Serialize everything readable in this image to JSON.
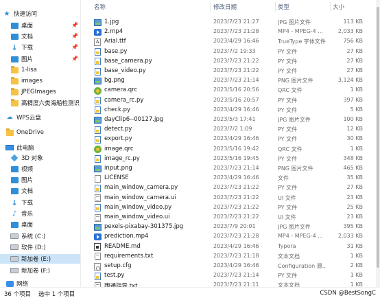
{
  "sidebar": {
    "items": [
      {
        "label": "快速访问",
        "icon": "star-icon"
      },
      {
        "label": "桌面",
        "icon": "desktop-folder-icon",
        "pinned": true
      },
      {
        "label": "文档",
        "icon": "documents-folder-icon",
        "pinned": true
      },
      {
        "label": "下载",
        "icon": "download-arrow-icon",
        "pinned": true
      },
      {
        "label": "图片",
        "icon": "pictures-folder-icon",
        "pinned": true
      },
      {
        "label": "1-lisa",
        "icon": "folder-icon"
      },
      {
        "label": "images",
        "icon": "folder-icon"
      },
      {
        "label": "JPEGImages",
        "icon": "folder-icon"
      },
      {
        "label": "高精度六类海船检测识",
        "icon": "folder-icon"
      },
      {
        "label": "WPS云盘",
        "icon": "cloud-icon"
      },
      {
        "label": "OneDrive",
        "icon": "onedrive-folder-icon"
      },
      {
        "label": "此电脑",
        "icon": "computer-icon"
      },
      {
        "label": "3D 对象",
        "icon": "3d-objects-icon"
      },
      {
        "label": "视频",
        "icon": "videos-folder-icon"
      },
      {
        "label": "图片",
        "icon": "pictures-folder-icon"
      },
      {
        "label": "文档",
        "icon": "documents-folder-icon"
      },
      {
        "label": "下载",
        "icon": "download-arrow-icon"
      },
      {
        "label": "音乐",
        "icon": "music-icon"
      },
      {
        "label": "桌面",
        "icon": "desktop-folder-icon"
      },
      {
        "label": "系统 (C:)",
        "icon": "drive-icon"
      },
      {
        "label": "软件 (D:)",
        "icon": "drive-icon"
      },
      {
        "label": "新加卷 (E:)",
        "icon": "drive-icon",
        "selected": true
      },
      {
        "label": "新加卷 (F:)",
        "icon": "drive-icon"
      },
      {
        "label": "网络",
        "icon": "network-icon"
      }
    ]
  },
  "columns": {
    "name": "名称",
    "date": "修改日期",
    "type": "类型",
    "size": "大小"
  },
  "files": [
    {
      "name": "1.jpg",
      "date": "2023/7/23 21:27",
      "type": "JPG 图片文件",
      "size": "113 KB",
      "icon": "image-file-icon"
    },
    {
      "name": "2.mp4",
      "date": "2023/7/23 21:28",
      "type": "MP4 - MPEG-4 ...",
      "size": "2,033 KB",
      "icon": "video-file-icon"
    },
    {
      "name": "Arial.ttf",
      "date": "2023/4/29 16:46",
      "type": "TrueType 字体文件",
      "size": "756 KB",
      "icon": "font-file-icon"
    },
    {
      "name": "base.py",
      "date": "2023/7/2 19:33",
      "type": "PY 文件",
      "size": "27 KB",
      "icon": "python-file-icon"
    },
    {
      "name": "base_camera.py",
      "date": "2023/7/23 21:22",
      "type": "PY 文件",
      "size": "27 KB",
      "icon": "python-file-icon"
    },
    {
      "name": "base_video.py",
      "date": "2023/7/23 21:22",
      "type": "PY 文件",
      "size": "27 KB",
      "icon": "python-file-icon"
    },
    {
      "name": "bg.png",
      "date": "2023/7/23 21:14",
      "type": "PNG 图片文件",
      "size": "3,124 KB",
      "icon": "image-file-icon"
    },
    {
      "name": "camera.qrc",
      "date": "2023/5/16 20:56",
      "type": "QRC 文件",
      "size": "1 KB",
      "icon": "qrc-file-icon"
    },
    {
      "name": "camera_rc.py",
      "date": "2023/5/16 20:57",
      "type": "PY 文件",
      "size": "397 KB",
      "icon": "python-file-icon"
    },
    {
      "name": "check.py",
      "date": "2023/4/29 16:46",
      "type": "PY 文件",
      "size": "5 KB",
      "icon": "python-file-icon"
    },
    {
      "name": "dayClip6--00127.jpg",
      "date": "2023/5/3 17:41",
      "type": "JPG 图片文件",
      "size": "100 KB",
      "icon": "image-file-icon"
    },
    {
      "name": "detect.py",
      "date": "2023/7/2 1:09",
      "type": "PY 文件",
      "size": "12 KB",
      "icon": "python-file-icon"
    },
    {
      "name": "export.py",
      "date": "2023/4/29 16:46",
      "type": "PY 文件",
      "size": "30 KB",
      "icon": "python-file-icon"
    },
    {
      "name": "image.qrc",
      "date": "2023/5/16 19:42",
      "type": "QRC 文件",
      "size": "1 KB",
      "icon": "qrc-file-icon"
    },
    {
      "name": "image_rc.py",
      "date": "2023/5/16 19:45",
      "type": "PY 文件",
      "size": "348 KB",
      "icon": "python-file-icon"
    },
    {
      "name": "input.png",
      "date": "2023/7/23 21:14",
      "type": "PNG 图片文件",
      "size": "465 KB",
      "icon": "image-file-icon"
    },
    {
      "name": "LICENSE",
      "date": "2023/4/29 16:46",
      "type": "文件",
      "size": "35 KB",
      "icon": "blank-file-icon"
    },
    {
      "name": "main_window_camera.py",
      "date": "2023/7/23 21:22",
      "type": "PY 文件",
      "size": "27 KB",
      "icon": "python-file-icon"
    },
    {
      "name": "main_window_camera.ui",
      "date": "2023/7/23 21:22",
      "type": "UI 文件",
      "size": "23 KB",
      "icon": "text-file-icon"
    },
    {
      "name": "main_window_video.py",
      "date": "2023/7/23 21:22",
      "type": "PY 文件",
      "size": "25 KB",
      "icon": "python-file-icon"
    },
    {
      "name": "main_window_video.ui",
      "date": "2023/7/23 21:22",
      "type": "UI 文件",
      "size": "23 KB",
      "icon": "text-file-icon"
    },
    {
      "name": "pexels-pixabay-301375.jpg",
      "date": "2023/7/9 20:01",
      "type": "JPG 图片文件",
      "size": "395 KB",
      "icon": "image-file-icon"
    },
    {
      "name": "prediction.mp4",
      "date": "2023/7/23 21:28",
      "type": "MP4 - MPEG-4 ...",
      "size": "2,033 KB",
      "icon": "video-file-icon"
    },
    {
      "name": "README.md",
      "date": "2023/4/29 16:46",
      "type": "Typora",
      "size": "31 KB",
      "icon": "markdown-file-icon"
    },
    {
      "name": "requirements.txt",
      "date": "2023/7/23 21:18",
      "type": "文本文档",
      "size": "1 KB",
      "icon": "text-file-icon"
    },
    {
      "name": "setup.cfg",
      "date": "2023/4/29 16:46",
      "type": "Configuration 源...",
      "size": "2 KB",
      "icon": "config-file-icon"
    },
    {
      "name": "test.py",
      "date": "2023/7/23 21:14",
      "type": "PY 文件",
      "size": "1 KB",
      "icon": "python-file-icon"
    },
    {
      "name": "跑通指导.txt",
      "date": "2023/7/23 21:11",
      "type": "文本文档",
      "size": "1 KB",
      "icon": "text-file-icon"
    }
  ],
  "status": {
    "item_count": "36 个项目",
    "selected": "选中 1 个项目"
  },
  "watermark": "CSDN @BestSongC",
  "colors": {
    "selected_bg": "#cce4f7",
    "accent": "#2f8fd8",
    "header_text": "#4c607a"
  }
}
